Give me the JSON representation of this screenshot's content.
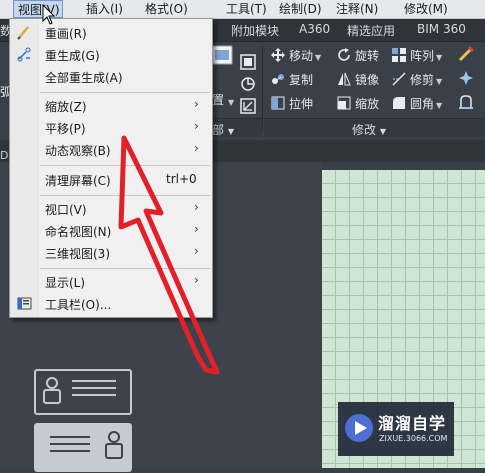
{
  "menubar": {
    "items": [
      {
        "label": "视图(V)",
        "active": true
      },
      {
        "label": "插入(I)"
      },
      {
        "label": "格式(O)"
      },
      {
        "label": "工具(T)"
      },
      {
        "label": "绘制(D)"
      },
      {
        "label": "注释(N)"
      },
      {
        "label": "修改(M)"
      }
    ]
  },
  "ribbon_tabs": [
    "附加模块",
    "A360",
    "精选应用",
    "BIM 360"
  ],
  "ribbon_fragments": {
    "left_partial": "数",
    "left_partial2": "弧",
    "under_menu_bu": "部",
    "under_menu_zhi": "置"
  },
  "modify_panel": {
    "move": "移动",
    "rotate": "旋转",
    "array": "阵列",
    "copy": "复制",
    "mirror": "镜像",
    "trim": "修剪",
    "stretch": "拉伸",
    "scale": "缩放",
    "fillet": "圆角",
    "label": "修改"
  },
  "doc": {
    "left_partial": "Dr"
  },
  "dropdown": {
    "items": [
      {
        "label": "重画(R)",
        "icon": "redraw-pen-icon"
      },
      {
        "label": "重生成(G)",
        "icon": "regen-icon"
      },
      {
        "label": "全部重生成(A)"
      },
      {
        "label": "缩放(Z)",
        "submenu": true
      },
      {
        "label": "平移(P)",
        "submenu": true
      },
      {
        "label": "动态观察(B)",
        "submenu": true
      },
      {
        "label": "清理屏幕(C)",
        "shortcut": "trl+0"
      },
      {
        "label": "视口(V)",
        "submenu": true
      },
      {
        "label": "命名视图(N)",
        "submenu": true
      },
      {
        "label": "三维视图(3)",
        "submenu": true
      },
      {
        "label": "显示(L)",
        "submenu": true
      },
      {
        "label": "工具栏(O)...",
        "icon": "toolbar-icon"
      }
    ]
  },
  "watermark": {
    "title": "溜溜自学",
    "url": "ZIXUE.3066.COM"
  },
  "colors": {
    "annotation_arrow": "#e3202a",
    "grid_background": "#cfe6d4",
    "menu_highlight": "#c4d7ee",
    "ribbon_background": "#3a4048"
  }
}
